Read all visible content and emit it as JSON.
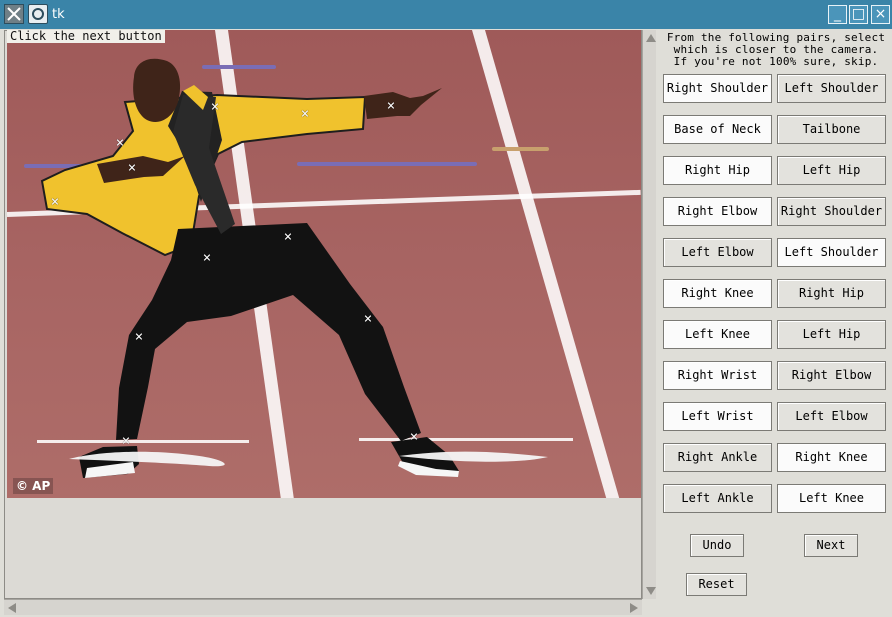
{
  "window": {
    "title": "tk",
    "buttons": {
      "minimize": "_",
      "maximize": "□",
      "close": "×"
    }
  },
  "canvas": {
    "status_text": "Click the next button",
    "watermark": "© AP",
    "markers": [
      {
        "name": "top-shoulder",
        "glyph": "×"
      },
      {
        "name": "upper-arm",
        "glyph": "×"
      },
      {
        "name": "wrist-right",
        "glyph": "×"
      },
      {
        "name": "left-shoulder",
        "glyph": "×"
      },
      {
        "name": "left-elbow",
        "glyph": "×"
      },
      {
        "name": "left-hand",
        "glyph": "×"
      },
      {
        "name": "right-hip",
        "glyph": "×"
      },
      {
        "name": "left-hip",
        "glyph": "×"
      },
      {
        "name": "right-knee",
        "glyph": "×"
      },
      {
        "name": "left-knee",
        "glyph": "×"
      },
      {
        "name": "right-ankle",
        "glyph": "×"
      },
      {
        "name": "left-ankle",
        "glyph": "×"
      }
    ]
  },
  "instructions": "From the following pairs, select\nwhich is closer to the camera.\nIf you're not 100% sure, skip.",
  "pairs": [
    {
      "left": "Right Shoulder",
      "right": "Left Shoulder"
    },
    {
      "left": "Base of Neck",
      "right": "Tailbone"
    },
    {
      "left": "Right Hip",
      "right": "Left Hip"
    },
    {
      "left": "Right Elbow",
      "right": "Right Shoulder"
    },
    {
      "left": "Left Elbow",
      "right": "Left Shoulder"
    },
    {
      "left": "Right Knee",
      "right": "Right Hip"
    },
    {
      "left": "Left Knee",
      "right": "Left Hip"
    },
    {
      "left": "Right Wrist",
      "right": "Right Elbow"
    },
    {
      "left": "Left Wrist",
      "right": "Left Elbow"
    },
    {
      "left": "Right Ankle",
      "right": "Right Knee"
    },
    {
      "left": "Left Ankle",
      "right": "Left Knee"
    }
  ],
  "controls": {
    "undo": "Undo",
    "next": "Next",
    "reset": "Reset"
  },
  "colors": {
    "titlebar": "#3a84a8",
    "track": "#a86563",
    "jacket": "#f0c22d"
  }
}
